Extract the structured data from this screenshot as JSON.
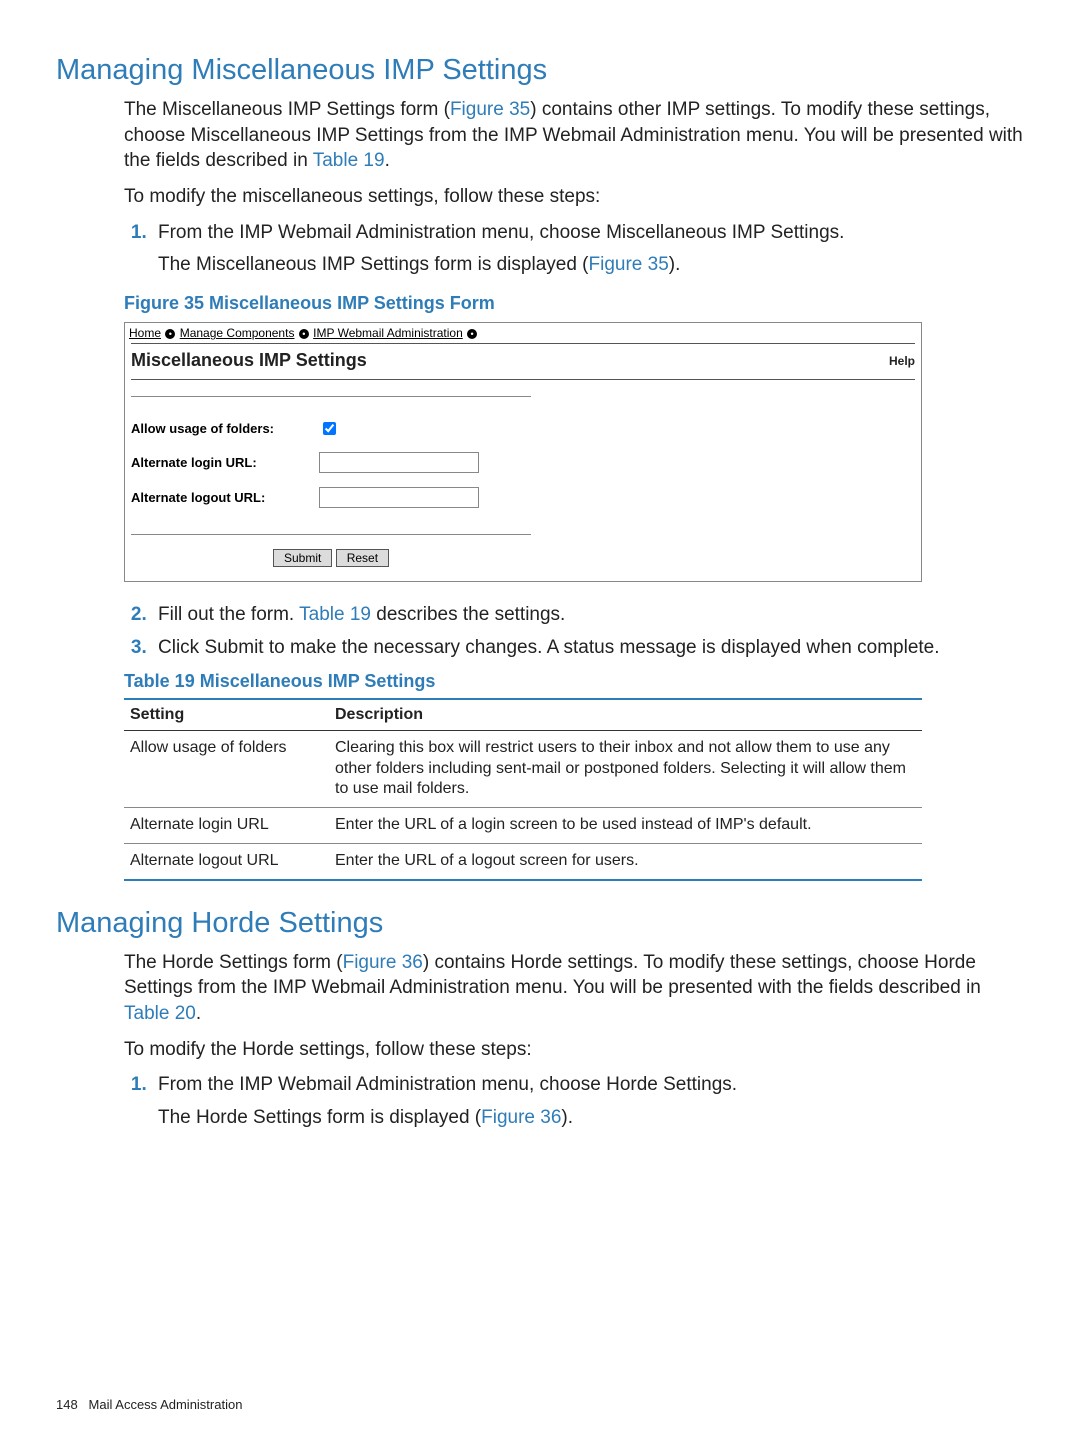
{
  "sec1": {
    "heading": "Managing Miscellaneous IMP Settings",
    "intro_1a": "The Miscellaneous IMP Settings form (",
    "intro_fig_link": "Figure 35",
    "intro_1b": ") contains other IMP settings. To modify these settings, choose Miscellaneous IMP Settings from the IMP Webmail Administration menu. You will be presented with the fields described in ",
    "intro_tbl_link": "Table 19",
    "intro_1c": ".",
    "para2": "To modify the miscellaneous settings, follow these steps:",
    "step1": "From the IMP Webmail Administration menu, choose Miscellaneous IMP Settings.",
    "step1_sub_a": "The Miscellaneous IMP Settings form is displayed (",
    "step1_sub_link": "Figure 35",
    "step1_sub_b": ").",
    "fig_caption": "Figure 35 Miscellaneous IMP Settings Form",
    "crumbs": {
      "home": "Home",
      "mc": "Manage Components",
      "imp": "IMP Webmail Administration"
    },
    "form": {
      "title": "Miscellaneous IMP Settings",
      "help": "Help",
      "allow_label": "Allow usage of folders:",
      "allow_checked": true,
      "login_label": "Alternate login URL:",
      "login_value": "",
      "logout_label": "Alternate logout URL:",
      "logout_value": "",
      "submit": "Submit",
      "reset": "Reset"
    },
    "step2_a": "Fill out the form. ",
    "step2_link": "Table 19",
    "step2_b": " describes the settings.",
    "step3": "Click Submit to make the necessary changes. A status message is displayed when complete.",
    "table_caption": "Table 19 Miscellaneous IMP Settings",
    "table": {
      "col_setting": "Setting",
      "col_desc": "Description",
      "rows": [
        {
          "setting": "Allow usage of folders",
          "desc": "Clearing this box will restrict users to their inbox and not allow them to use any other folders including sent-mail or postponed folders. Selecting it will allow them to use mail folders."
        },
        {
          "setting": "Alternate login URL",
          "desc": "Enter the URL of a login screen to be used instead of IMP's default."
        },
        {
          "setting": "Alternate logout URL",
          "desc": "Enter the URL of a logout screen for users."
        }
      ]
    }
  },
  "sec2": {
    "heading": "Managing Horde Settings",
    "intro_1a": "The Horde Settings form (",
    "intro_fig_link": "Figure 36",
    "intro_1b": ") contains Horde settings. To modify these settings, choose Horde Settings from the IMP Webmail Administration menu. You will be presented with the fields described in ",
    "intro_tbl_link": "Table 20",
    "intro_1c": ".",
    "para2": "To modify the Horde settings, follow these steps:",
    "step1": "From the IMP Webmail Administration menu, choose Horde Settings.",
    "step1_sub_a": "The Horde Settings form is displayed (",
    "step1_sub_link": "Figure 36",
    "step1_sub_b": ")."
  },
  "footer": {
    "page": "148",
    "chapter": "Mail Access Administration"
  }
}
